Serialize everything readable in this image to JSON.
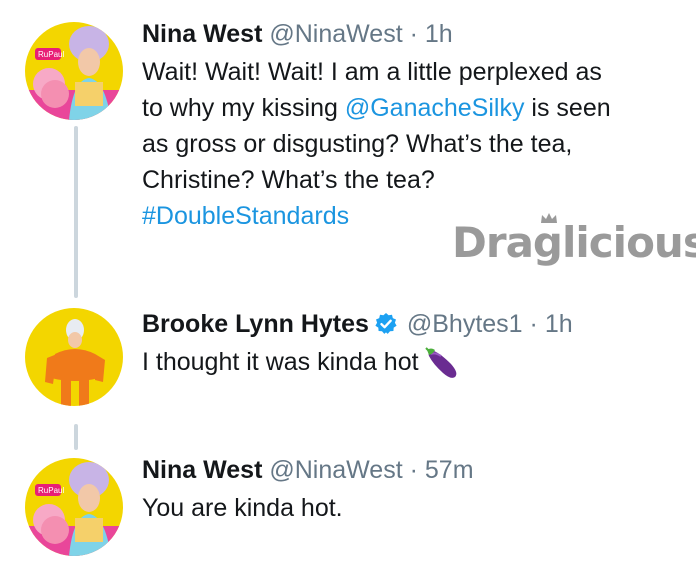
{
  "tweets": [
    {
      "name": "Nina West",
      "handle": "@NinaWest",
      "separator": "·",
      "time": "1h",
      "text_lines": [
        "Wait! Wait! Wait! I am a little perplexed as",
        "to why my kissing ",
        "as gross or disgusting? What’s the tea,",
        "Christine? What’s the tea?"
      ],
      "mention": "@GanacheSilky",
      "text_after_mention": " is seen",
      "hashtag": "#DoubleStandards",
      "avatar_icon": "nina-west-avatar"
    },
    {
      "name": "Brooke Lynn Hytes",
      "handle": "@Bhytes1",
      "separator": "·",
      "time": "1h",
      "verified": true,
      "text": "I thought it was kinda hot",
      "emoji_icon": "eggplant-icon",
      "avatar_icon": "brooke-lynn-avatar"
    },
    {
      "name": "Nina West",
      "handle": "@NinaWest",
      "separator": "·",
      "time": "57m",
      "text": "You are kinda hot.",
      "avatar_icon": "nina-west-avatar"
    }
  ],
  "watermark": "Draglicious",
  "colors": {
    "link": "#1b95e0",
    "muted": "#657786",
    "thread_line": "#ccd6dd",
    "avatar_bg": "#f3d600"
  }
}
